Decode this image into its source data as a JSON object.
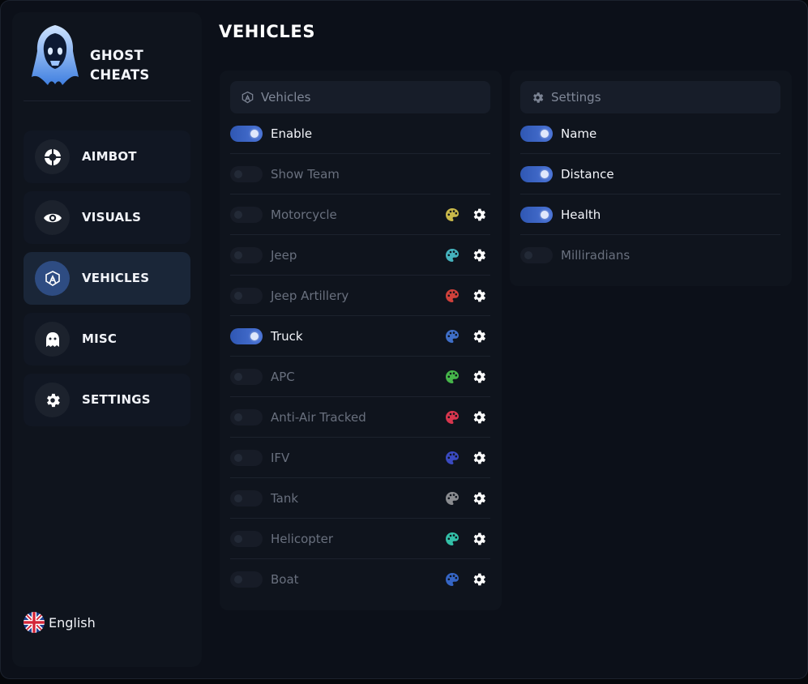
{
  "brand": {
    "line1": "GHOST",
    "line2": "CHEATS"
  },
  "nav": [
    {
      "label": "AIMBOT",
      "icon": "crosshair-icon",
      "active": false
    },
    {
      "label": "VISUALS",
      "icon": "eye-icon",
      "active": false
    },
    {
      "label": "VEHICLES",
      "icon": "vehicle-icon",
      "active": true
    },
    {
      "label": "MISC",
      "icon": "ghost-icon",
      "active": false
    },
    {
      "label": "SETTINGS",
      "icon": "gear-icon",
      "active": false
    }
  ],
  "language": {
    "label": "English",
    "icon": "uk-flag-icon"
  },
  "page": {
    "title": "VEHICLES"
  },
  "vehicles_panel": {
    "title": "Vehicles",
    "icon": "vehicle-icon",
    "rows": [
      {
        "label": "Enable",
        "enabled": true
      },
      {
        "label": "Show Team",
        "enabled": false
      },
      {
        "label": "Motorcycle",
        "enabled": false,
        "color": "#c8b84a"
      },
      {
        "label": "Jeep",
        "enabled": false,
        "color": "#45b2bd"
      },
      {
        "label": "Jeep Artillery",
        "enabled": false,
        "color": "#d0413b"
      },
      {
        "label": "Truck",
        "enabled": true,
        "color": "#3f6fc8"
      },
      {
        "label": "APC",
        "enabled": false,
        "color": "#46b64a"
      },
      {
        "label": "Anti-Air Tracked",
        "enabled": false,
        "color": "#d8364e"
      },
      {
        "label": "IFV",
        "enabled": false,
        "color": "#3a4ac0"
      },
      {
        "label": "Tank",
        "enabled": false,
        "color": "#8a8c90"
      },
      {
        "label": "Helicopter",
        "enabled": false,
        "color": "#33c0a8"
      },
      {
        "label": "Boat",
        "enabled": false,
        "color": "#3565c5"
      }
    ]
  },
  "settings_panel": {
    "title": "Settings",
    "icon": "gear-icon",
    "rows": [
      {
        "label": "Name",
        "enabled": true
      },
      {
        "label": "Distance",
        "enabled": true
      },
      {
        "label": "Health",
        "enabled": true
      },
      {
        "label": "Milliradians",
        "enabled": false
      }
    ]
  }
}
